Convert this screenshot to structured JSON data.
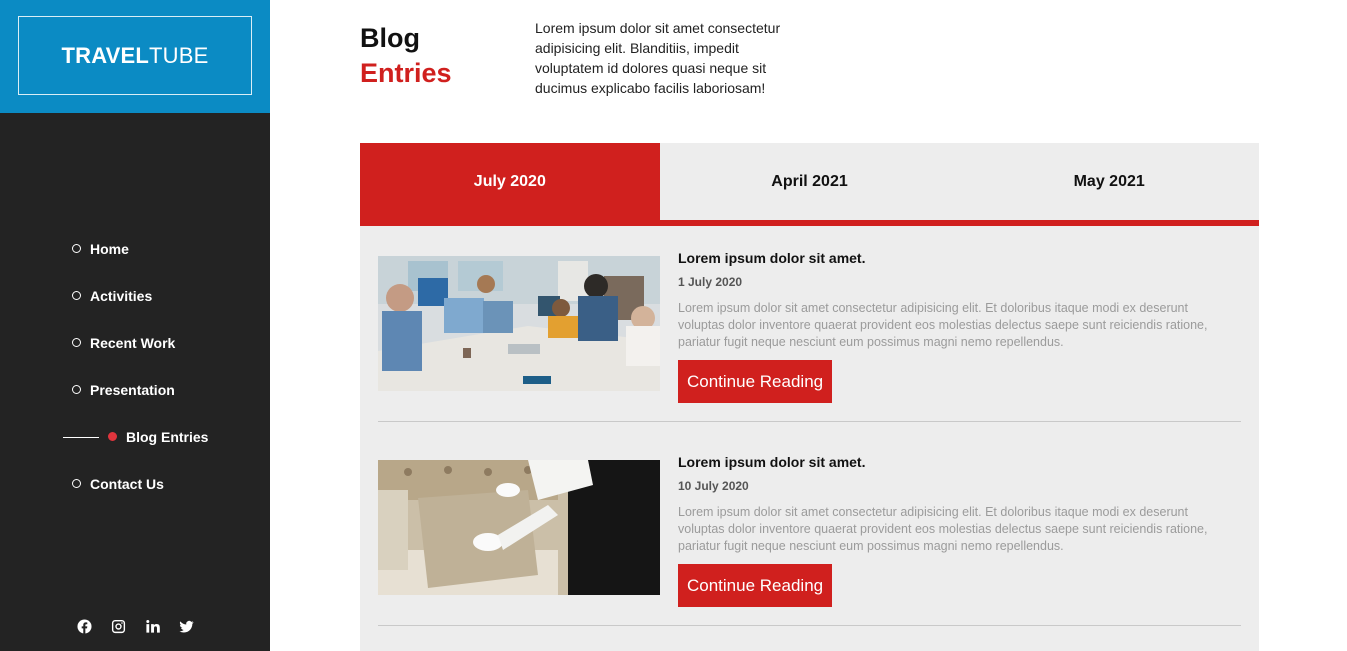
{
  "brand": {
    "bold": "TRAVEL",
    "light": "TUBE"
  },
  "nav": [
    {
      "label": "Home",
      "active": false
    },
    {
      "label": "Activities",
      "active": false
    },
    {
      "label": "Recent Work",
      "active": false
    },
    {
      "label": "Presentation",
      "active": false
    },
    {
      "label": "Blog Entries",
      "active": true
    },
    {
      "label": "Contact Us",
      "active": false
    }
  ],
  "social": [
    "facebook-icon",
    "instagram-icon",
    "linkedin-icon",
    "twitter-icon"
  ],
  "header": {
    "title_line1": "Blog",
    "title_line2": "Entries",
    "intro": "Lorem ipsum dolor sit amet consectetur adipisicing elit. Blanditiis, impedit voluptatem id dolores quasi neque sit ducimus explicabo facilis laboriosam!"
  },
  "tabs": [
    {
      "label": "July 2020",
      "active": true
    },
    {
      "label": "April 2021",
      "active": false
    },
    {
      "label": "May 2021",
      "active": false
    }
  ],
  "entries": [
    {
      "title": "Lorem ipsum dolor sit amet.",
      "date": "1 July 2020",
      "text": "Lorem ipsum dolor sit amet consectetur adipisicing elit. Et doloribus itaque modi ex deserunt voluptas dolor inventore quaerat provident eos molestias delectus saepe sunt reiciendis ratione, pariatur fugit neque nesciunt eum possimus magni nemo repellendus.",
      "button": "Continue Reading"
    },
    {
      "title": "Lorem ipsum dolor sit amet.",
      "date": "10 July 2020",
      "text": "Lorem ipsum dolor sit amet consectetur adipisicing elit. Et doloribus itaque modi ex deserunt voluptas dolor inventore quaerat provident eos molestias delectus saepe sunt reiciendis ratione, pariatur fugit neque nesciunt eum possimus magni nemo repellendus.",
      "button": "Continue Reading"
    }
  ],
  "colors": {
    "accent": "#d0201e",
    "brand": "#0b8bc4",
    "sidebar": "#232323",
    "panel": "#ededed"
  }
}
